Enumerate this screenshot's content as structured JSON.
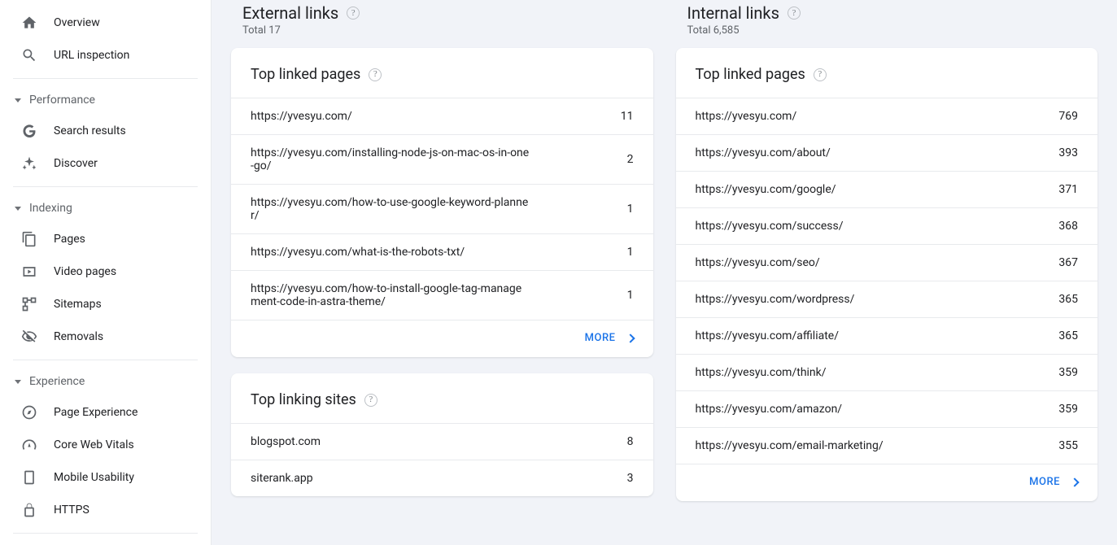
{
  "sidebar": {
    "top": [
      {
        "label": "Overview",
        "icon": "home"
      },
      {
        "label": "URL inspection",
        "icon": "search"
      }
    ],
    "groups": [
      {
        "title": "Performance",
        "items": [
          {
            "label": "Search results",
            "icon": "google-g"
          },
          {
            "label": "Discover",
            "icon": "sparkle"
          }
        ]
      },
      {
        "title": "Indexing",
        "items": [
          {
            "label": "Pages",
            "icon": "pages"
          },
          {
            "label": "Video pages",
            "icon": "video"
          },
          {
            "label": "Sitemaps",
            "icon": "sitemap"
          },
          {
            "label": "Removals",
            "icon": "visibility-off"
          }
        ]
      },
      {
        "title": "Experience",
        "items": [
          {
            "label": "Page Experience",
            "icon": "compass"
          },
          {
            "label": "Core Web Vitals",
            "icon": "speedometer"
          },
          {
            "label": "Mobile Usability",
            "icon": "smartphone"
          },
          {
            "label": "HTTPS",
            "icon": "lock"
          }
        ]
      }
    ]
  },
  "external": {
    "title": "External links",
    "total_label": "Total 17",
    "top_pages": {
      "title": "Top linked pages",
      "rows": [
        {
          "url": "https://yvesyu.com/",
          "count": "11"
        },
        {
          "url": "https://yvesyu.com/installing-node-js-on-mac-os-in-one-go/",
          "count": "2"
        },
        {
          "url": "https://yvesyu.com/how-to-use-google-keyword-planner/",
          "count": "1"
        },
        {
          "url": "https://yvesyu.com/what-is-the-robots-txt/",
          "count": "1"
        },
        {
          "url": "https://yvesyu.com/how-to-install-google-tag-management-code-in-astra-theme/",
          "count": "1"
        }
      ],
      "more": "MORE"
    },
    "top_sites": {
      "title": "Top linking sites",
      "rows": [
        {
          "url": "blogspot.com",
          "count": "8"
        },
        {
          "url": "siterank.app",
          "count": "3"
        }
      ]
    }
  },
  "internal": {
    "title": "Internal links",
    "total_label": "Total 6,585",
    "top_pages": {
      "title": "Top linked pages",
      "rows": [
        {
          "url": "https://yvesyu.com/",
          "count": "769"
        },
        {
          "url": "https://yvesyu.com/about/",
          "count": "393"
        },
        {
          "url": "https://yvesyu.com/google/",
          "count": "371"
        },
        {
          "url": "https://yvesyu.com/success/",
          "count": "368"
        },
        {
          "url": "https://yvesyu.com/seo/",
          "count": "367"
        },
        {
          "url": "https://yvesyu.com/wordpress/",
          "count": "365"
        },
        {
          "url": "https://yvesyu.com/affiliate/",
          "count": "365"
        },
        {
          "url": "https://yvesyu.com/think/",
          "count": "359"
        },
        {
          "url": "https://yvesyu.com/amazon/",
          "count": "359"
        },
        {
          "url": "https://yvesyu.com/email-marketing/",
          "count": "355"
        }
      ],
      "more": "MORE"
    }
  }
}
